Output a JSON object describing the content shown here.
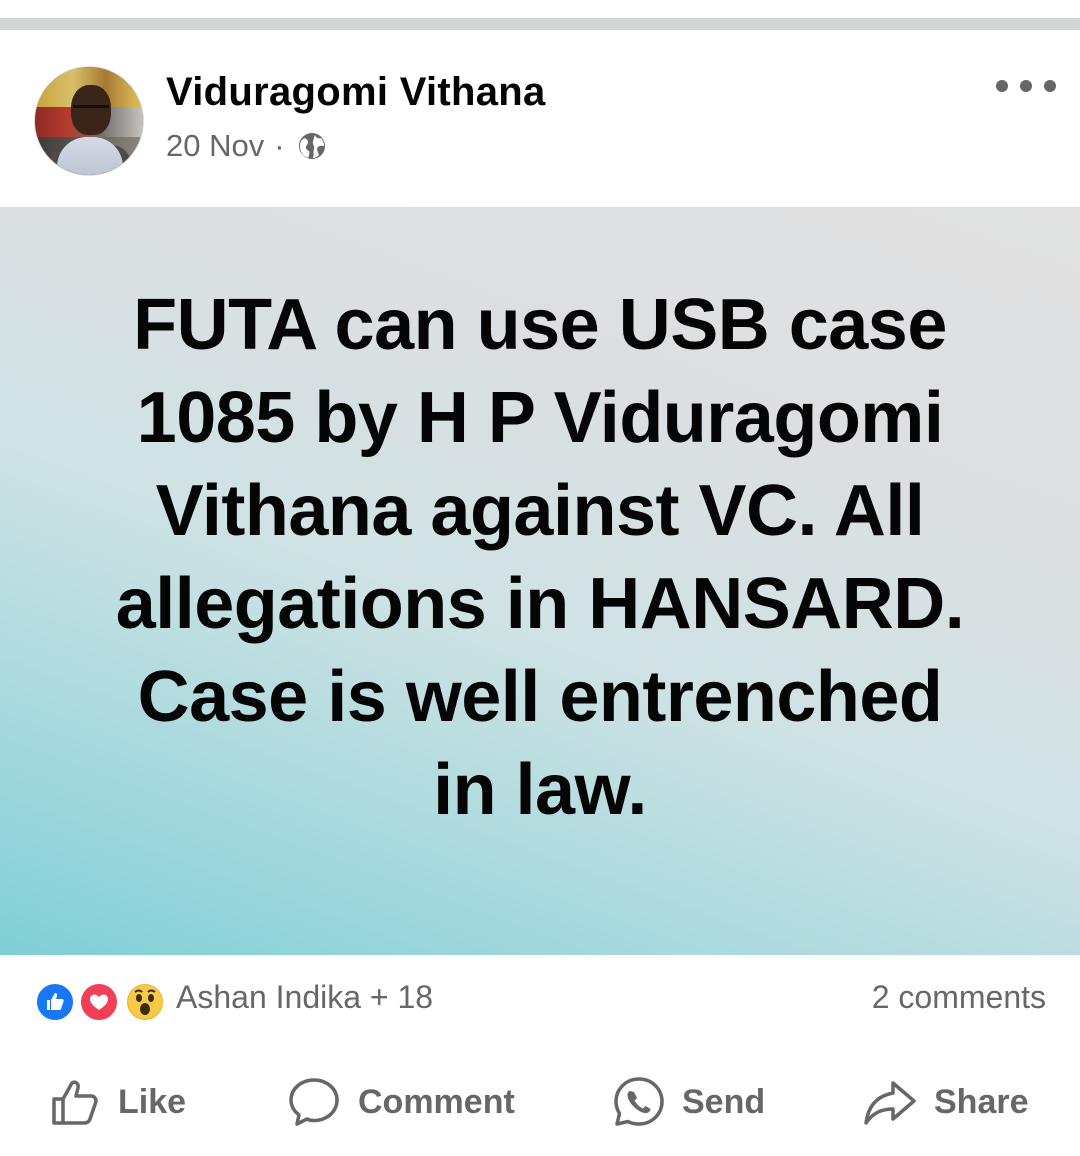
{
  "post": {
    "author": "Viduragomi Vithana",
    "date": "20 Nov",
    "separator": "·",
    "audience_icon": "globe-icon",
    "more_icon": "more-options-icon",
    "text_lines": [
      "FUTA can use USB case",
      "1085 by H P Viduragomi",
      "Vithana against VC. All",
      "allegations in HANSARD.",
      "Case is well entrenched",
      "in law."
    ],
    "background_gradient": [
      "#7fcfd6",
      "#e1e1e1"
    ]
  },
  "reactions": {
    "icons": [
      "like-reaction-icon",
      "love-reaction-icon",
      "wow-reaction-icon"
    ],
    "names": "Ashan Indika + 18",
    "comments": "2 comments"
  },
  "actions": {
    "like": "Like",
    "comment": "Comment",
    "send": "Send",
    "share": "Share"
  },
  "colors": {
    "text_primary": "#050505",
    "text_secondary": "#65676b",
    "like_blue": "#1877f2",
    "love_red": "#f33e58",
    "wow_yellow": "#f7b125"
  }
}
